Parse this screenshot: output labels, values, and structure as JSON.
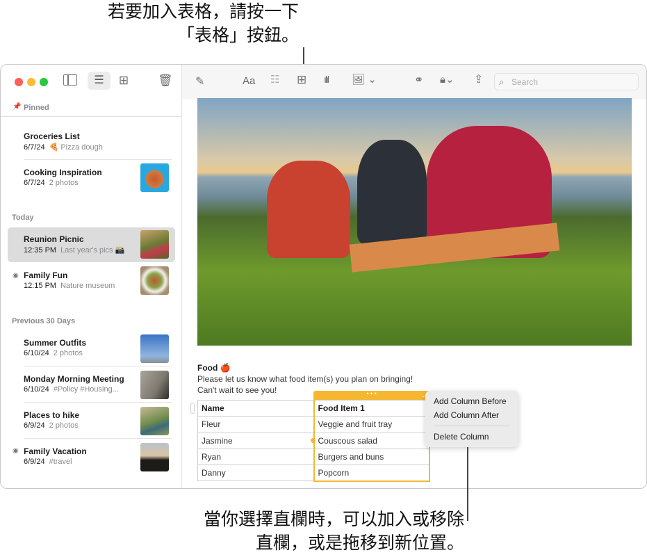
{
  "callouts": {
    "top_line1": "若要加入表格，請按一下",
    "top_line2": "「表格」按鈕。",
    "bottom_line1": "當你選擇直欄時，可以加入或移除",
    "bottom_line2": "直欄，或是拖移到新位置。"
  },
  "sidebar": {
    "pinned_label": "Pinned",
    "today_label": "Today",
    "previous_label": "Previous 30 Days",
    "notes": [
      {
        "title": "Groceries List",
        "date": "6/7/24",
        "preview": "🍕 Pizza dough"
      },
      {
        "title": "Cooking Inspiration",
        "date": "6/7/24",
        "preview": "2 photos"
      },
      {
        "title": "Reunion Picnic",
        "date": "12:35 PM",
        "preview": "Last year's pics 📸",
        "selected": true
      },
      {
        "title": "Family Fun",
        "date": "12:15 PM",
        "preview": "Nature museum",
        "shared": true
      },
      {
        "title": "Summer Outfits",
        "date": "6/10/24",
        "preview": "2 photos"
      },
      {
        "title": "Monday Morning Meeting",
        "date": "6/10/24",
        "preview": "#Policy #Housing..."
      },
      {
        "title": "Places to hike",
        "date": "6/9/24",
        "preview": "2 photos"
      },
      {
        "title": "Family Vacation",
        "date": "6/9/24",
        "preview": "#travel",
        "shared": true
      }
    ]
  },
  "toolbar": {
    "format_label": "Aa",
    "search_placeholder": "Search"
  },
  "note": {
    "heading": "Food 🍎",
    "line1": "Please let us know what food item(s) you plan on bringing!",
    "line2": "Can't wait to see you!",
    "table": {
      "headers": [
        "Name",
        "Food Item 1"
      ],
      "rows": [
        [
          "Fleur",
          "Veggie and fruit tray"
        ],
        [
          "Jasmine",
          "Couscous salad"
        ],
        [
          "Ryan",
          "Burgers and buns"
        ],
        [
          "Danny",
          "Popcorn"
        ]
      ]
    }
  },
  "column_menu": {
    "items": [
      "Add Column Before",
      "Add Column After",
      "Delete Column"
    ]
  },
  "colors": {
    "accent": "#f5b731",
    "selected_row": "#dcdcdc"
  }
}
